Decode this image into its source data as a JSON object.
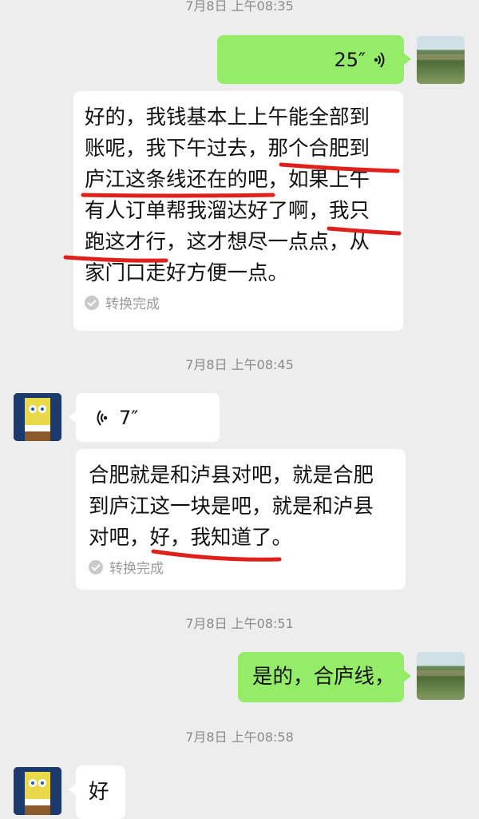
{
  "timestamps": [
    "7月8日 上午08:35",
    "7月8日 上午08:45",
    "7月8日 上午08:51",
    "7月8日 上午08:58"
  ],
  "colors": {
    "background": "#ededed",
    "outgoing_bubble": "#95ec69",
    "incoming_bubble": "#ffffff",
    "annotation_red": "#e0201b"
  },
  "messages": {
    "m1": {
      "sender": "me",
      "type": "voice",
      "duration": "25″",
      "icon": "voice-wave-icon"
    },
    "m2": {
      "sender": "me",
      "type": "transcription",
      "lines": [
        "好的，我钱基本上上午能全部到",
        "账呢，我下午过去，那个合肥到",
        "庐江这条线还在的吧，如果上午",
        "有人订单帮我溜达好了啊，我只",
        "跑这才行，这才想尽一点点，从",
        "家门口走好方便一点。"
      ],
      "status": "转换完成"
    },
    "m3": {
      "sender": "other",
      "type": "voice",
      "duration": "7″",
      "icon": "voice-wave-icon"
    },
    "m4": {
      "sender": "other",
      "type": "transcription",
      "lines": [
        "合肥就是和泸县对吧，就是合肥",
        "到庐江这一块是吧，就是和泸县",
        "对吧，好，我知道了。"
      ],
      "status": "转换完成"
    },
    "m5": {
      "sender": "me",
      "type": "text",
      "text": "是的，合庐线，"
    },
    "m6": {
      "sender": "other",
      "type": "text",
      "text": "好"
    }
  }
}
